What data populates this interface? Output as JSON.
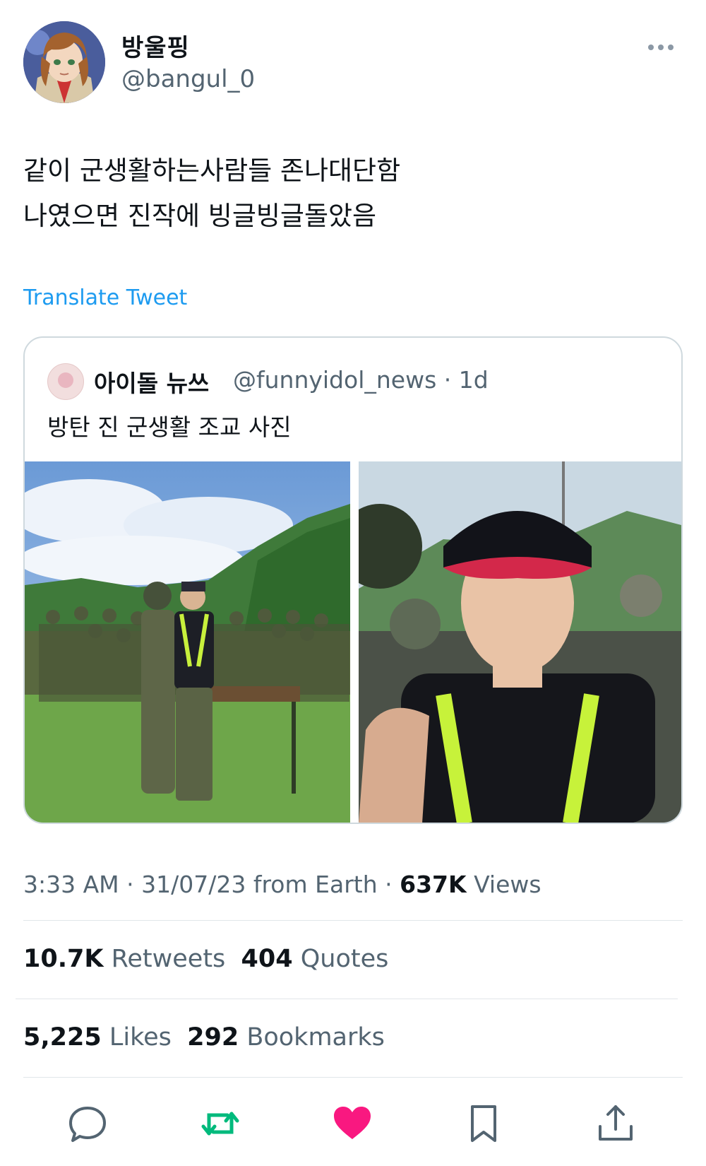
{
  "author": {
    "display_name": "방울핑",
    "handle": "@bangul_0"
  },
  "tweet": {
    "text": "같이 군생활하는사람들 존나대단함\n나였으면 진작에 빙글빙글돌았음",
    "translate_label": "Translate Tweet"
  },
  "quoted_tweet": {
    "display_name": "아이돌 뉴쓰",
    "handle": "@funnyidol_news",
    "time": "· 1d",
    "text": "방탄 진 군생활 조교 사진"
  },
  "meta": {
    "time": "3:33 AM",
    "date": "· 31/07/23 from Earth ·",
    "views_count": "637K",
    "views_label": "Views"
  },
  "stats": {
    "retweets_count": "10.7K",
    "retweets_label": "Retweets",
    "quotes_count": "404",
    "quotes_label": "Quotes",
    "likes_count": "5,225",
    "likes_label": "Likes",
    "bookmarks_count": "292",
    "bookmarks_label": "Bookmarks"
  },
  "colors": {
    "link": "#1d9bf0",
    "retweet": "#00ba7c",
    "like": "#f91880",
    "icon_gray": "#536471"
  },
  "icons": [
    "more-icon",
    "reply-icon",
    "retweet-icon",
    "like-icon",
    "bookmark-icon",
    "share-icon"
  ]
}
